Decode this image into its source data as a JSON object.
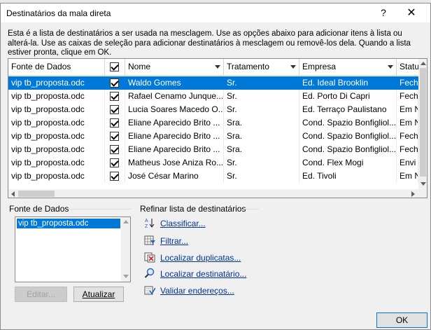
{
  "dialog": {
    "title": "Destinatários da mala direta",
    "help_glyph": "?",
    "close_glyph": "✕",
    "description": "Esta é a lista de destinatários a ser usada na mesclagem. Use as opções abaixo para adicionar itens à lista ou alterá-la. Use as caixas de seleção para adicionar destinatários à mesclagem ou removê-los dela. Quando a lista estiver pronta, clique em OK."
  },
  "grid": {
    "columns": [
      "Fonte de Dados",
      "",
      "Nome",
      "Tratamento",
      "Empresa",
      "Status"
    ],
    "rows": [
      {
        "source": "vip tb_proposta.odc",
        "checked": true,
        "name": "Waldo Gomes",
        "title": "Sr.",
        "company": "Ed. Ideal Brooklin",
        "status": "Fech"
      },
      {
        "source": "vip tb_proposta.odc",
        "checked": true,
        "name": "Rafael Cenamo Junque...",
        "title": "Sr.",
        "company": "Ed. Porto Di Capri",
        "status": "Fech"
      },
      {
        "source": "vip tb_proposta.odc",
        "checked": true,
        "name": "Lucia Soares Macedo O...",
        "title": "Sr.",
        "company": "Ed. Terraço Paulistano",
        "status": "Em N"
      },
      {
        "source": "vip tb_proposta.odc",
        "checked": true,
        "name": "Eliane Aparecido Brito ...",
        "title": "Sra.",
        "company": "Cond. Spazio Bonfigliol...",
        "status": "Em N"
      },
      {
        "source": "vip tb_proposta.odc",
        "checked": true,
        "name": "Eliane Aparecido Brito ...",
        "title": "Sra.",
        "company": "Cond. Spazio Bonfigliol...",
        "status": "Fech"
      },
      {
        "source": "vip tb_proposta.odc",
        "checked": true,
        "name": "Eliane Aparecido Brito ...",
        "title": "Sra.",
        "company": "Cond. Spazio Bonfigliol...",
        "status": "Fech"
      },
      {
        "source": "vip tb_proposta.odc",
        "checked": true,
        "name": "Matheus Jose Aniza Ro...",
        "title": "Sr.",
        "company": "Cond. Flex Mogi",
        "status": "Envi"
      },
      {
        "source": "vip tb_proposta.odc",
        "checked": true,
        "name": "José César Marino",
        "title": "Sr.",
        "company": "Ed. Tivoli",
        "status": "Em N"
      }
    ]
  },
  "datasource": {
    "label": "Fonte de Dados",
    "items": [
      "vip tb_proposta.odc"
    ],
    "edit_label": "Editar...",
    "refresh_label": "Atualizar"
  },
  "refine": {
    "label": "Refinar lista de destinatários",
    "sort": "Classificar...",
    "filter": "Filtrar...",
    "duplicates": "Localizar duplicatas...",
    "find": "Localizar destinatário...",
    "validate": "Validar endereços..."
  },
  "ok_label": "OK",
  "colors": {
    "selection": "#0078d7",
    "link": "#003399"
  }
}
